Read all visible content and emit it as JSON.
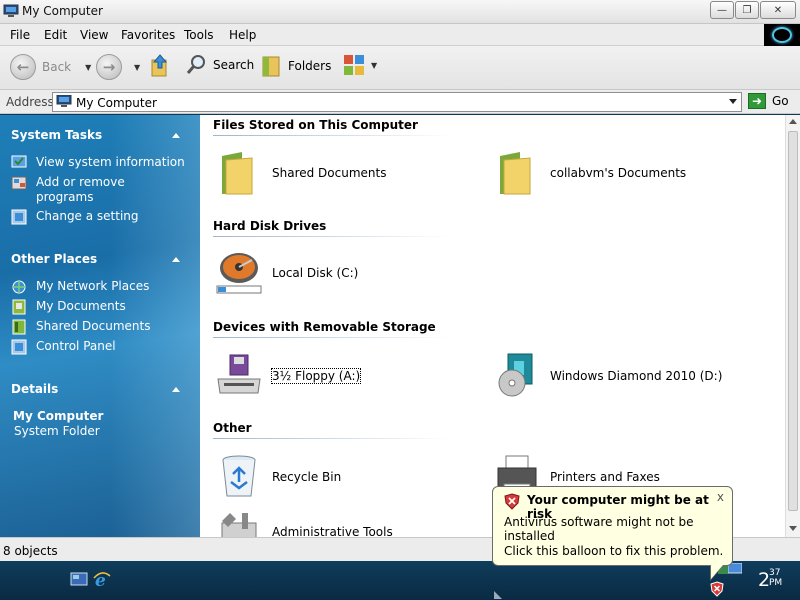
{
  "window": {
    "title": "My Computer"
  },
  "menu": [
    "File",
    "Edit",
    "View",
    "Favorites",
    "Tools",
    "Help"
  ],
  "toolbar": {
    "back_label": "Back",
    "search_label": "Search",
    "folders_label": "Folders"
  },
  "address": {
    "label": "Address",
    "value": "My Computer",
    "go_label": "Go"
  },
  "left_panel": {
    "system_tasks": {
      "title": "System Tasks",
      "items": [
        "View system information",
        "Add or remove programs",
        "Change a setting"
      ]
    },
    "other_places": {
      "title": "Other Places",
      "items": [
        "My Network Places",
        "My Documents",
        "Shared Documents",
        "Control Panel"
      ]
    },
    "details": {
      "title": "Details",
      "name": "My Computer",
      "type": "System Folder"
    }
  },
  "sections": {
    "files": {
      "title": "Files Stored on This Computer",
      "items": [
        "Shared Documents",
        "collabvm's Documents"
      ]
    },
    "hard_disks": {
      "title": "Hard Disk Drives",
      "items": [
        "Local Disk (C:)"
      ]
    },
    "removable": {
      "title": "Devices with Removable Storage",
      "items": [
        "3½ Floppy (A:)",
        "Windows Diamond 2010 (D:)"
      ]
    },
    "other": {
      "title": "Other",
      "items": [
        "Recycle Bin",
        "Printers and Faxes",
        "Administrative Tools"
      ]
    }
  },
  "status": {
    "text": "8 objects"
  },
  "balloon": {
    "title": "Your computer might be at risk",
    "line1": "Antivirus software might not be installed",
    "line2": "Click this balloon to fix this problem.",
    "close": "x"
  },
  "clock": {
    "hour": "2",
    "minute": "37",
    "ampm": "PM"
  },
  "colors": {
    "panel_blue": "#1f7fb8",
    "balloon_bg": "#ffffe1",
    "accent_green": "#2f9a37"
  }
}
